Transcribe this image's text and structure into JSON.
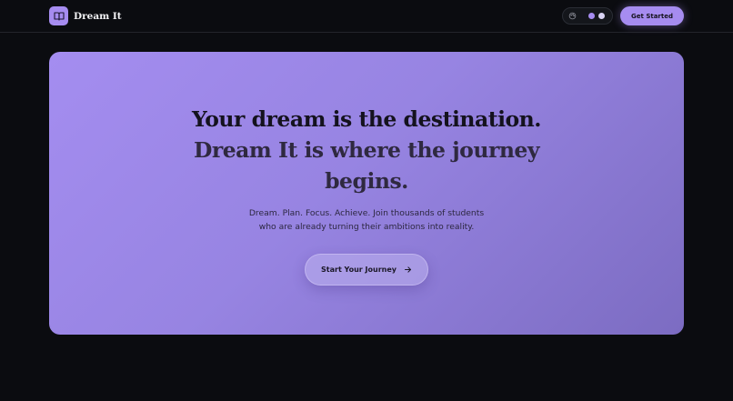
{
  "navbar": {
    "brand_name": "Dream It",
    "get_started_label": "Get Started"
  },
  "hero": {
    "title_line_1": "Your dream is the destination.",
    "title_line_2": "Dream It is where the journey",
    "title_line_3": "begins.",
    "subtitle_line_1": "Dream. Plan. Focus. Achieve. Join thousands of students",
    "subtitle_line_2": "who are already turning their ambitions into reality.",
    "cta_label": "Start Your Journey"
  },
  "icons": {
    "brand": "book-open-icon",
    "theme": "palette-icon",
    "cta": "arrow-right-icon"
  },
  "colors": {
    "page_background": "#0b0c10",
    "accent": "#a68cf0",
    "hero_gradient_start": "#a48df0",
    "hero_gradient_end": "#7c6cc2",
    "theme_dot_1": "#a68cf0",
    "theme_dot_2": "#d8d2f2"
  }
}
